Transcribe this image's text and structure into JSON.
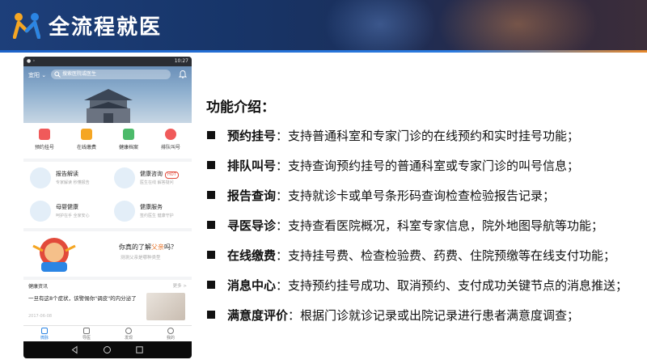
{
  "header": {
    "title": "全流程就医"
  },
  "phone": {
    "status_time": "10:27",
    "city": "宜阳",
    "search_placeholder": "搜索医院或医生",
    "quick_actions": [
      {
        "label": "预约挂号",
        "icon": "calendar-icon",
        "color": "#f05a5a"
      },
      {
        "label": "在线缴费",
        "icon": "payment-icon",
        "color": "#f5a623"
      },
      {
        "label": "健康档案",
        "icon": "record-icon",
        "color": "#4cba6a"
      },
      {
        "label": "排队叫号",
        "icon": "alarm-icon",
        "color": "#f05a5a"
      }
    ],
    "services": [
      {
        "title": "报告解读",
        "sub": "专家解读 秒懂报告"
      },
      {
        "title": "健康咨询",
        "sub": "医生在线 解答疑问",
        "badge": "HOT"
      },
      {
        "title": "母婴健康",
        "sub": "呵护在手 全家安心"
      },
      {
        "title": "健康服务",
        "sub": "签约医生 健康守护"
      }
    ],
    "promo": {
      "question_pre": "你真的了解",
      "question_hl": "父亲",
      "question_post": "吗？",
      "sub": "测测父亲是哪种类型"
    },
    "news": {
      "heading": "健康资讯",
      "more": "更多 >",
      "title": "一旦有这8个症状，该警惕你\"调皮\"的内分泌了",
      "date": "2017-06-08"
    },
    "tabs": [
      {
        "label": "微脉",
        "active": true
      },
      {
        "label": "导医",
        "active": false
      },
      {
        "label": "发现",
        "active": false
      },
      {
        "label": "我的",
        "active": false
      }
    ]
  },
  "features": {
    "heading": "功能介绍：",
    "items": [
      {
        "name": "预约挂号",
        "desc": "：支持普通科室和专家门诊的在线预约和实时挂号功能；"
      },
      {
        "name": "排队叫号",
        "desc": "：支持查询预约挂号的普通科室或专家门诊的叫号信息；"
      },
      {
        "name": "报告查询",
        "desc": "：支持就诊卡或单号条形码查询检查检验报告记录；"
      },
      {
        "name": "寻医导诊",
        "desc": "：支持查看医院概况，科室专家信息，院外地图导航等功能；"
      },
      {
        "name": "在线缴费",
        "desc": "：支持挂号费、检查检验费、药费、住院预缴等在线支付功能；"
      },
      {
        "name": "消息中心",
        "desc": "：支持预约挂号成功、取消预约、支付成功关键节点的消息推送；"
      },
      {
        "name": "满意度评价",
        "desc": "：根据门诊就诊记录或出院记录进行患者满意度调查；"
      }
    ]
  }
}
